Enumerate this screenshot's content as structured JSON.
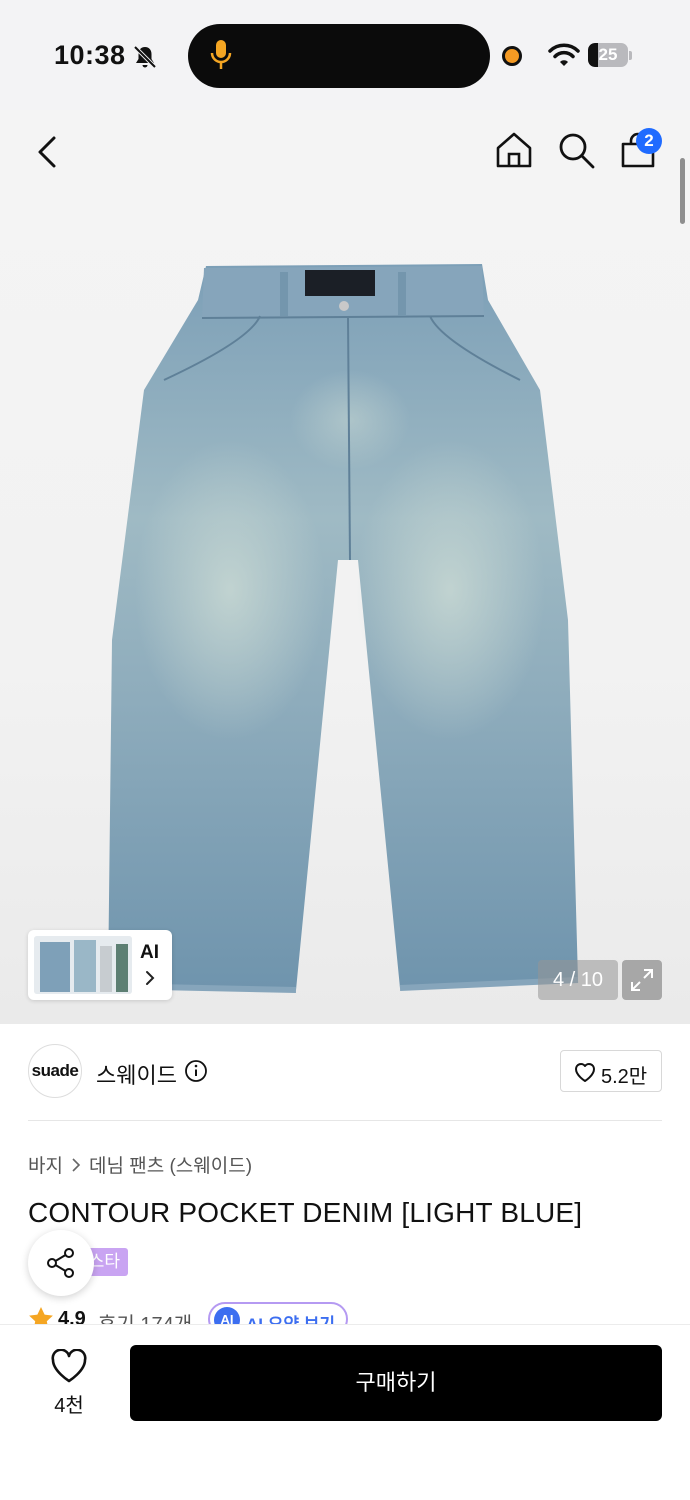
{
  "status_bar": {
    "time": "10:38",
    "battery": "25",
    "battery_fraction": 0.25
  },
  "header": {
    "cart_badge": "2"
  },
  "gallery": {
    "thumb_label": "AI",
    "counter": "4 / 10"
  },
  "brand": {
    "logo_text": "suade",
    "name": "스웨이드",
    "likes": "5.2만"
  },
  "product": {
    "breadcrumb": [
      "바지",
      "데님 팬츠 (스웨이드)"
    ],
    "title": "CONTOUR POCKET DENIM [LIGHT BLUE]",
    "tag": "스타",
    "rating": "4.9",
    "reviews": "후기 174개",
    "ai_badge": "AI",
    "ai_summary": "AI 요약 보기"
  },
  "bottom_bar": {
    "wish_count": "4천",
    "buy_label": "구매하기"
  },
  "colors": {
    "accent_blue": "#1f6bff",
    "tag_purple": "#c9a4f2",
    "ai_blue": "#3c6ef0",
    "buy_button": "#000000"
  },
  "icons": [
    "bell-slash-icon",
    "mic-icon",
    "wifi-icon",
    "back-icon",
    "home-icon",
    "search-icon",
    "shopping-bag-icon",
    "chevron-right-icon",
    "expand-icon",
    "info-icon",
    "heart-icon",
    "share-icon",
    "star-icon"
  ]
}
